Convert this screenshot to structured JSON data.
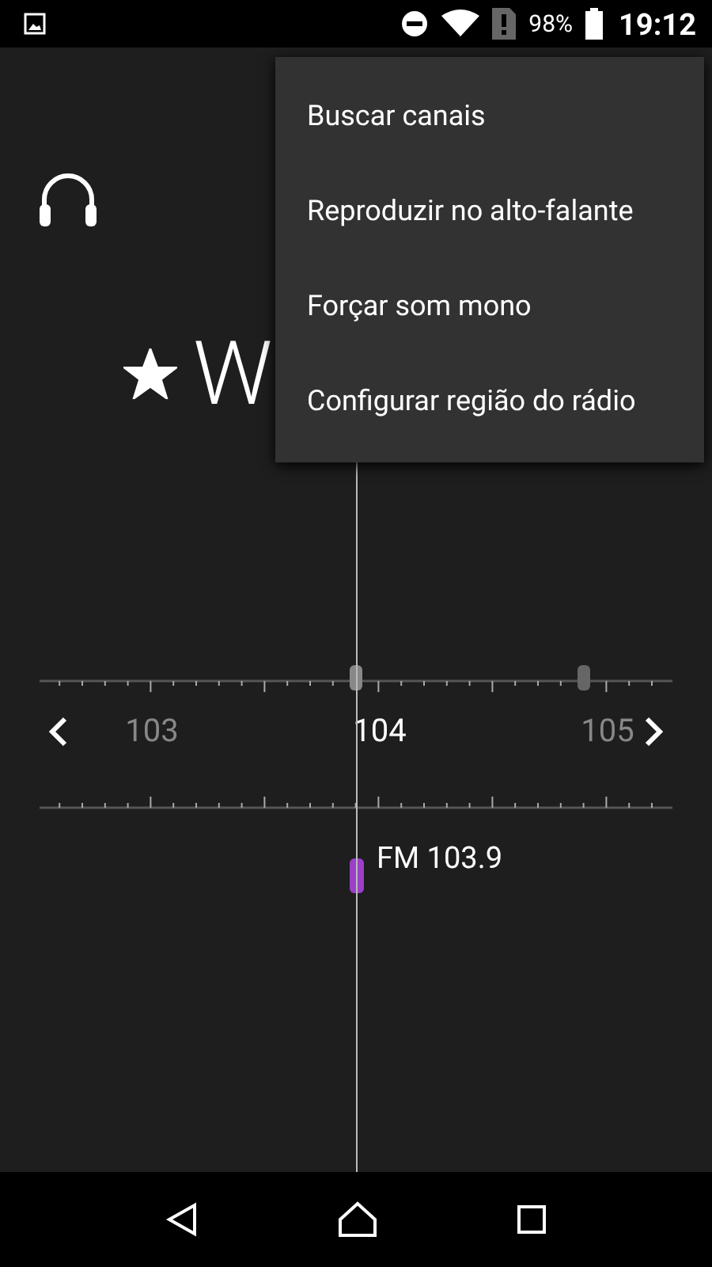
{
  "status_bar": {
    "battery": "98%",
    "time": "19:12"
  },
  "station": {
    "name": "W",
    "favorite": true
  },
  "dial": {
    "labels": [
      {
        "text": "103",
        "selected": false
      },
      {
        "text": "104",
        "selected": true
      },
      {
        "text": "105",
        "selected": false
      }
    ],
    "frequency": "FM 103.9"
  },
  "menu": {
    "items": [
      "Buscar canais",
      "Reproduzir no alto-falante",
      "Forçar som mono",
      "Configurar região do rádio"
    ]
  }
}
